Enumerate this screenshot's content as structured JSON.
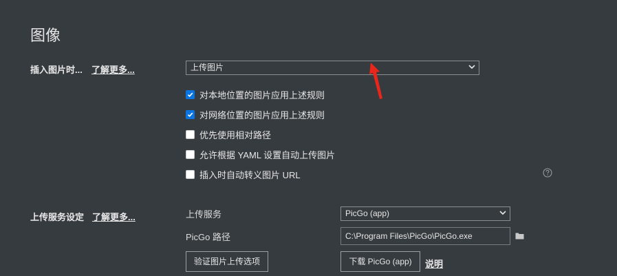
{
  "page": {
    "title": "图像"
  },
  "insert_section": {
    "label": "插入图片时...",
    "more_link": "了解更多...",
    "select_value": "上传图片",
    "checkboxes": [
      {
        "label": "对本地位置的图片应用上述规则",
        "checked": true
      },
      {
        "label": "对网络位置的图片应用上述规则",
        "checked": true
      },
      {
        "label": "优先使用相对路径",
        "checked": false
      },
      {
        "label": "允许根据 YAML 设置自动上传图片",
        "checked": false
      },
      {
        "label": "插入时自动转义图片 URL",
        "checked": false
      }
    ],
    "help_icon": "question-circle-icon"
  },
  "upload_section": {
    "label": "上传服务设定",
    "more_link": "了解更多...",
    "service_label": "上传服务",
    "service_value": "PicGo (app)",
    "path_label": "PicGo 路径",
    "path_value": "C:\\Program Files\\PicGo\\PicGo.exe",
    "folder_icon": "folder-icon",
    "verify_button": "验证图片上传选项",
    "download_button": "下载 PicGo (app)",
    "explain_link": "说明"
  },
  "annotation": {
    "arrow_color": "#e8261c"
  },
  "colors": {
    "background": "#363b40",
    "checkbox_checked": "#0a74e0"
  }
}
